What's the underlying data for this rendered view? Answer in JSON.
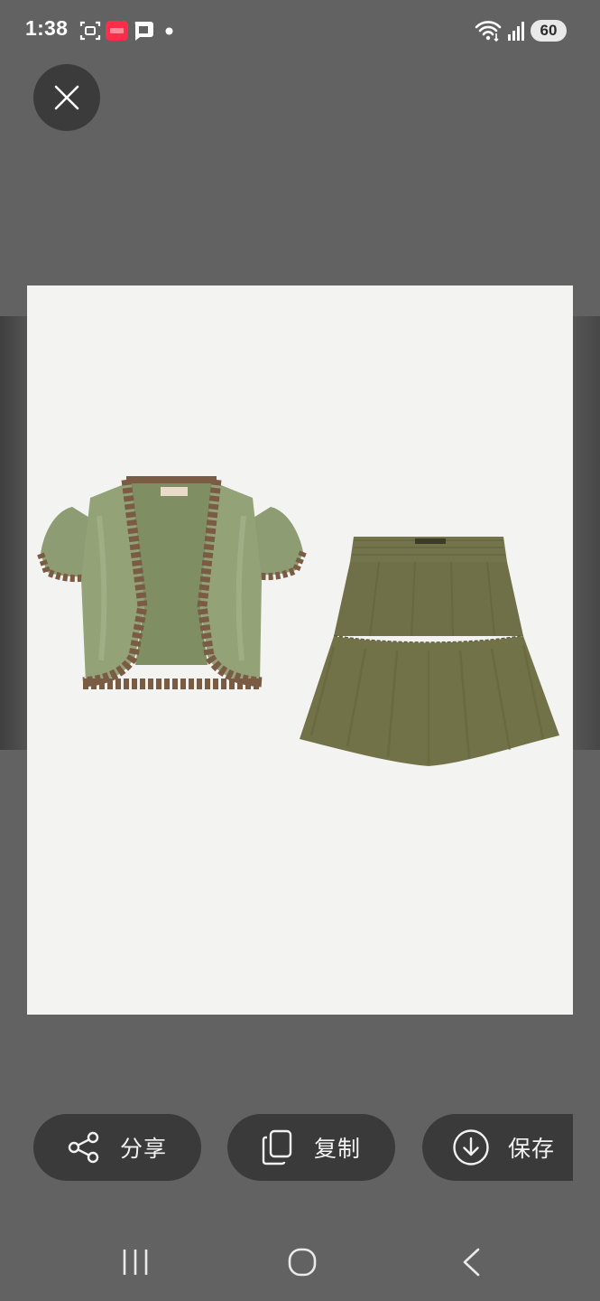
{
  "status_bar": {
    "time": "1:38",
    "battery": "60",
    "icons": [
      "screenshot-icon",
      "app-badge-icon",
      "message-icon",
      "dot-icon",
      "wifi-icon",
      "signal-icon"
    ]
  },
  "viewer": {
    "close_icon": "close-icon",
    "image_subject": "product-photo"
  },
  "actions": [
    {
      "label": "分享",
      "icon": "share-icon"
    },
    {
      "label": "复制",
      "icon": "copy-icon"
    },
    {
      "label": "保存",
      "icon": "download-icon"
    }
  ],
  "nav": {
    "icons": [
      "recent-apps-icon",
      "home-icon",
      "back-icon"
    ]
  },
  "colors": {
    "background": "#626262",
    "button_bg": "#3a3a3a",
    "photo_bg": "#f3f3f2",
    "garment_green": "#8a9a6e",
    "trim_brown": "#7a5c44",
    "skirt_olive": "#6f6f48"
  }
}
